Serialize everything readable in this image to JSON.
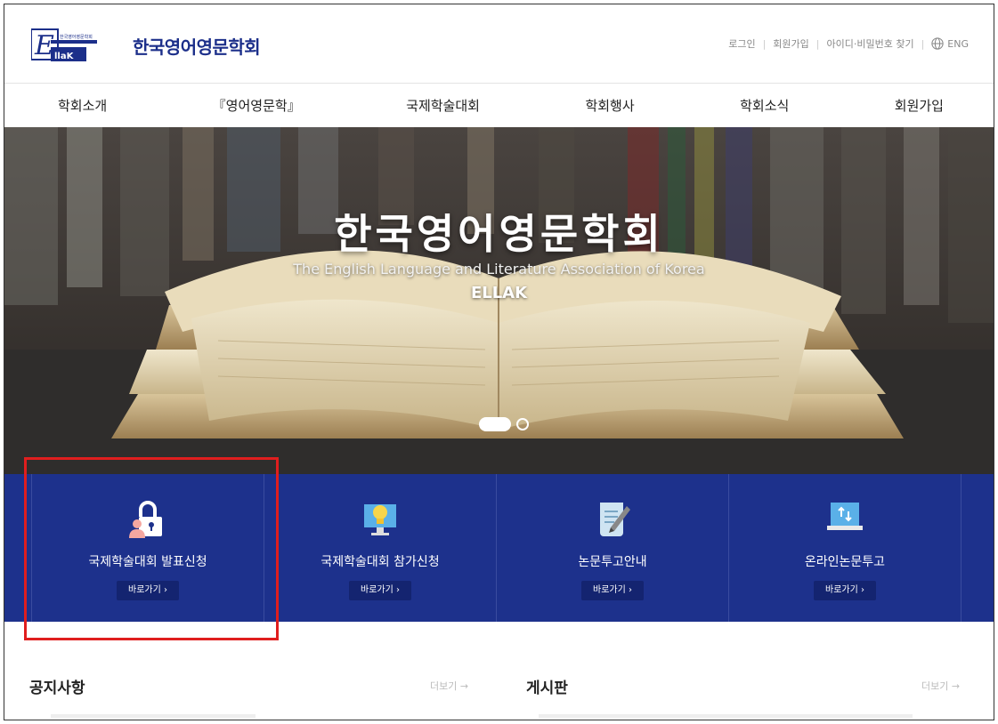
{
  "header": {
    "logo_small_text": "한국영어영문학회",
    "logo_mark_text": "ElLaK",
    "site_title": "한국영어영문학회",
    "util_links": [
      "로그인",
      "회원가입",
      "아이디·비밀번호 찾기"
    ],
    "language_label": "ENG"
  },
  "nav": {
    "items": [
      "학회소개",
      "『영어영문학』",
      "국제학술대회",
      "학회행사",
      "학회소식",
      "회원가입"
    ]
  },
  "hero": {
    "title": "한국영어영문학회",
    "subtitle": "The English Language and Literature Association of Korea",
    "abbr": "ELLAK",
    "slide_count": 2,
    "active_slide": 1
  },
  "quick_menu": {
    "items": [
      {
        "label": "국제학술대회 발표신청",
        "button": "바로가기 ›",
        "icon": "lock-user-icon"
      },
      {
        "label": "국제학술대회 참가신청",
        "button": "바로가기 ›",
        "icon": "monitor-bulb-icon"
      },
      {
        "label": "논문투고안내",
        "button": "바로가기 ›",
        "icon": "scroll-pen-icon"
      },
      {
        "label": "온라인논문투고",
        "button": "바로가기 ›",
        "icon": "upload-monitor-icon"
      }
    ],
    "highlighted_index": 0
  },
  "boards": {
    "notice_title": "공지사항",
    "notice_more": "더보기 →",
    "board_title": "게시판",
    "board_more": "더보기 →"
  },
  "colors": {
    "brand_navy": "#1d318c",
    "highlight_red": "#e01e1e"
  }
}
